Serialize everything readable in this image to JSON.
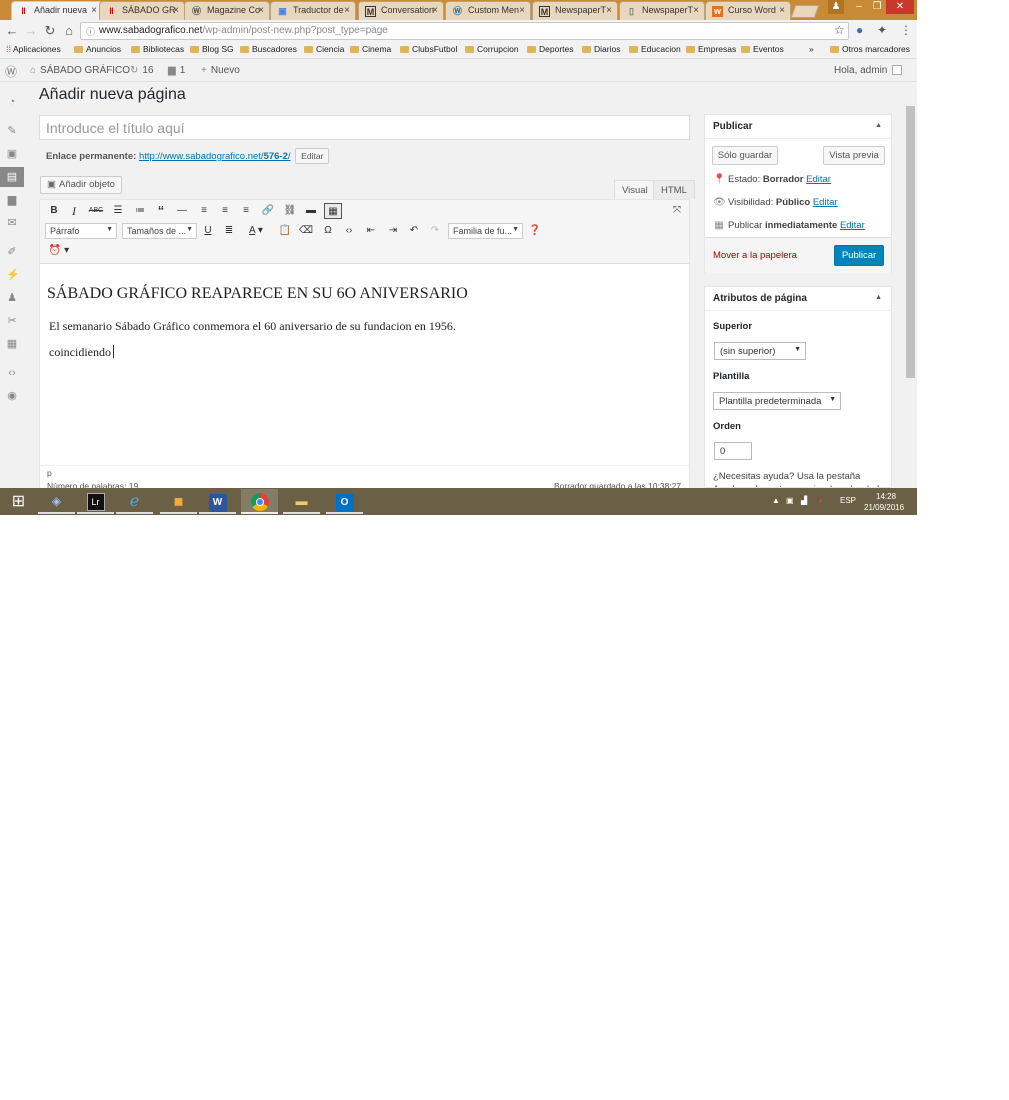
{
  "browser": {
    "tabs": [
      {
        "title": "Añadir nueva",
        "icon": "wordpress-red-icon",
        "active": true
      },
      {
        "title": "SÁBADO GR",
        "icon": "sabado-red-icon"
      },
      {
        "title": "Magazine Co",
        "icon": "wordpress-icon"
      },
      {
        "title": "Traductor de",
        "icon": "translate-icon"
      },
      {
        "title": "Conversation",
        "icon": "m-icon"
      },
      {
        "title": "Custom Men",
        "icon": "wordpress-icon"
      },
      {
        "title": "NewspaperT",
        "icon": "m-icon"
      },
      {
        "title": "NewspaperT",
        "icon": "page-icon"
      },
      {
        "title": "Curso Word",
        "icon": "w-orange-icon"
      }
    ],
    "tab_close": "×",
    "url_domain": "www.sabadografico.net",
    "url_path": "/wp-admin/post-new.php?post_type=page",
    "bookmarks": [
      "Aplicaciones",
      "Anuncios",
      "Bibliotecas",
      "Blog SG",
      "Buscadores",
      "Ciencia",
      "Cinema",
      "ClubsFutbol",
      "Corrupcion",
      "Deportes",
      "Diarios",
      "Educacion",
      "Empresas",
      "Eventos"
    ],
    "bookmarks_more": "»",
    "other_bookmarks": "Otros marcadores"
  },
  "adminbar": {
    "site_name": "SÁBADO GRÁFICO",
    "updates_count": "16",
    "comments_count": "1",
    "new_label": "Nuevo",
    "greeting": "Hola, admin"
  },
  "page": {
    "heading": "Añadir nueva página",
    "title_placeholder": "Introduce el título aquí",
    "permalink_label": "Enlace permanente:",
    "permalink_base": "http://www.sabadografico.net/",
    "permalink_slug": "576-2",
    "permalink_trail": "/",
    "permalink_edit": "Editar"
  },
  "editor": {
    "add_media": "Añadir objeto",
    "tab_visual": "Visual",
    "tab_html": "HTML",
    "format_select": "Párrafo",
    "size_select": "Tamaños de ...",
    "family_select": "Familia de fu...",
    "content_heading": "SÁBADO GRÁFICO REAPARECE EN SU 6O ANIVERSARIO",
    "content_p1": "El semanario Sábado Gráfico conmemora el 60 aniversario de su fundacion en 1956.",
    "content_p2": "coincidiendo",
    "path": "p",
    "word_count": "Número de palabras: 19",
    "draft_saved": "Borrador guardado a las 10:38:27."
  },
  "publish": {
    "title": "Publicar",
    "save_draft": "Sólo guardar",
    "preview": "Vista previa",
    "status_label": "Estado:",
    "status_value": "Borrador",
    "visibility_label": "Visibilidad:",
    "visibility_value": "Público",
    "schedule_label": "Publicar",
    "schedule_value": "inmediatamente",
    "edit": "Editar",
    "trash": "Mover a la papelera",
    "publish_button": "Publicar"
  },
  "attributes": {
    "title": "Atributos de página",
    "parent_label": "Superior",
    "parent_value": "(sin superior)",
    "template_label": "Plantilla",
    "template_value": "Plantilla predeterminada",
    "order_label": "Orden",
    "order_value": "0",
    "help_text": "¿Necesitas ayuda? Usa la pestaña Ayuda en la parte superior derecha de la"
  },
  "taskbar": {
    "language": "ESP",
    "time": "14:28",
    "date": "21/09/2016"
  },
  "colors": {
    "accent": "#0085ba",
    "link": "#0073aa",
    "trash": "#aa0000",
    "taskbar": "#6b6045",
    "tabbar": "#c98a36"
  }
}
